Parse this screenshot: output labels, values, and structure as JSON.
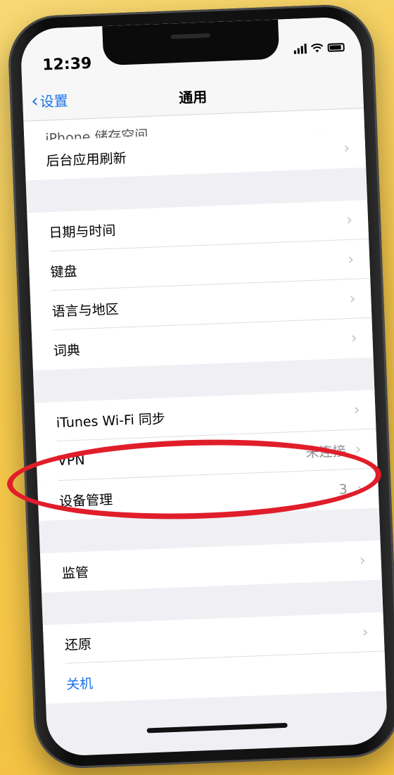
{
  "status_bar": {
    "time": "12:39"
  },
  "nav": {
    "back_label": "设置",
    "title": "通用"
  },
  "clipped_row": {
    "label": "iPhone 储存空间"
  },
  "groups": [
    {
      "items": [
        {
          "label": "后台应用刷新",
          "detail": "",
          "chevron": true
        }
      ]
    },
    {
      "items": [
        {
          "label": "日期与时间",
          "detail": "",
          "chevron": true
        },
        {
          "label": "键盘",
          "detail": "",
          "chevron": true
        },
        {
          "label": "语言与地区",
          "detail": "",
          "chevron": true
        },
        {
          "label": "词典",
          "detail": "",
          "chevron": true
        }
      ]
    },
    {
      "items": [
        {
          "label": "iTunes Wi-Fi 同步",
          "detail": "",
          "chevron": true
        },
        {
          "label": "VPN",
          "detail": "未连接",
          "chevron": true
        },
        {
          "label": "设备管理",
          "detail": "3",
          "chevron": true
        }
      ]
    },
    {
      "items": [
        {
          "label": "监管",
          "detail": "",
          "chevron": true
        }
      ]
    },
    {
      "items": [
        {
          "label": "还原",
          "detail": "",
          "chevron": true
        },
        {
          "label": "关机",
          "detail": "",
          "chevron": false
        }
      ]
    }
  ],
  "colors": {
    "accent": "#1a73e8",
    "annotation": "#e01e2a",
    "background": "#f5c94c"
  }
}
